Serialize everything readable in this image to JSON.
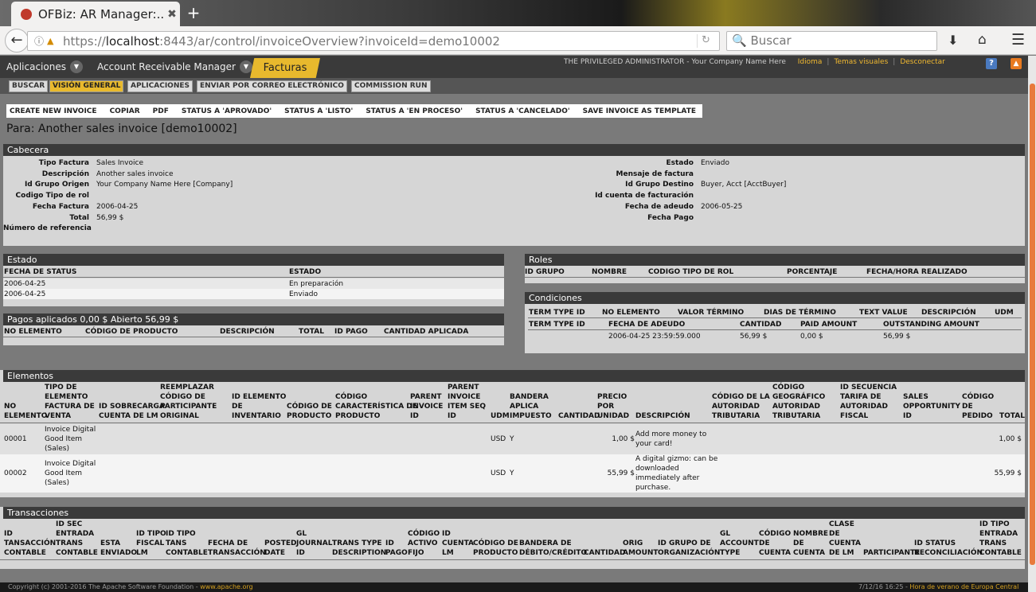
{
  "browser": {
    "tab_title": "OFBiz: AR Manager:...",
    "tab_close": "✖",
    "new_tab": "+",
    "back": "←",
    "url_host": "localhost",
    "url_prefix": "https://",
    "url_rest": ":8443/ar/control/invoiceOverview?invoiceId=demo10002",
    "search_placeholder": "Buscar"
  },
  "topnav": {
    "aplicaciones": "Aplicaciones",
    "account_manager": "Account Receivable Manager",
    "facturas": "Facturas",
    "user": "THE PRIVILEGED ADMINISTRATOR - Your Company Name Here",
    "idioma": "Idioma",
    "temas": "Temas visuales",
    "desconectar": "Desconectar",
    "help": "?"
  },
  "subnav": [
    "BUSCAR",
    "VISIÓN GENERAL",
    "APLICACIONES",
    "ENVIAR POR CORREO ELECTRÓNICO",
    "COMMISSION RUN"
  ],
  "actions": [
    "CREATE NEW INVOICE",
    "COPIAR",
    "PDF",
    "STATUS A 'APROVADO'",
    "STATUS A 'LISTO'",
    "STATUS A 'EN PROCESO'",
    "STATUS A 'CANCELADO'",
    "SAVE INVOICE AS TEMPLATE"
  ],
  "page_title": "Para: Another sales invoice [demo10002]",
  "cabecera": {
    "title": "Cabecera",
    "left": [
      {
        "k": "Tipo Factura",
        "v": "Sales Invoice"
      },
      {
        "k": "Descripción",
        "v": "Another sales invoice"
      },
      {
        "k": "Id Grupo Origen",
        "v": "Your Company Name Here [Company]"
      },
      {
        "k": "Codigo Tipo de rol",
        "v": ""
      },
      {
        "k": "Fecha Factura",
        "v": "2006-04-25"
      },
      {
        "k": "Total",
        "v": "56,99 $"
      },
      {
        "k": "Número de referencia",
        "v": ""
      }
    ],
    "right": [
      {
        "k": "Estado",
        "v": "Enviado"
      },
      {
        "k": "Mensaje de factura",
        "v": ""
      },
      {
        "k": "Id Grupo Destino",
        "v": "Buyer, Acct [AcctBuyer]"
      },
      {
        "k": "Id cuenta de facturación",
        "v": ""
      },
      {
        "k": "Fecha de adeudo",
        "v": "2006-05-25"
      },
      {
        "k": "Fecha Pago",
        "v": ""
      }
    ]
  },
  "estado": {
    "title": "Estado",
    "headers": [
      "FECHA DE STATUS",
      "ESTADO"
    ],
    "rows": [
      [
        "2006-04-25",
        "En preparación"
      ],
      [
        "2006-04-25",
        "Enviado"
      ]
    ]
  },
  "roles": {
    "title": "Roles",
    "headers": [
      "ID GRUPO",
      "NOMBRE",
      "CODIGO TIPO DE ROL",
      "PORCENTAJE",
      "FECHA/HORA REALIZADO"
    ]
  },
  "pagos": {
    "title": "Pagos aplicados 0,00 $ Abierto 56,99 $",
    "headers": [
      "NO ELEMENTO",
      "CÓDIGO DE PRODUCTO",
      "DESCRIPCIÓN",
      "TOTAL",
      "ID PAGO",
      "CANTIDAD APLICADA"
    ]
  },
  "condiciones": {
    "title": "Condiciones",
    "headers1": [
      "TERM TYPE ID",
      "NO ELEMENTO",
      "VALOR TÉRMINO",
      "DIAS DE TÉRMINO",
      "TEXT VALUE",
      "DESCRIPCIÓN",
      "UDM"
    ],
    "headers2": [
      "TERM TYPE ID",
      "FECHA DE ADEUDO",
      "CANTIDAD",
      "PAID AMOUNT",
      "OUTSTANDING AMOUNT"
    ],
    "row": [
      "",
      "2006-04-25 23:59:59.000",
      "56,99 $",
      "0,00 $",
      "56,99 $"
    ]
  },
  "elementos": {
    "title": "Elementos",
    "headers": [
      "NO\nELEMENTO",
      "TIPO DE\nELEMENTO\nFACTURA DE\nVENTA",
      "ID SOBRECARGA\nCUENTA DE LM",
      "REEMPLAZAR\nCÓDIGO DE\nPARTICIPANTE\nORIGINAL",
      "ID ELEMENTO\nDE\nINVENTARIO",
      "CÓDIGO DE\nPRODUCTO",
      "CÓDIGO\nCARACTERÍSTICA DE\nPRODUCTO",
      "PARENT\nINVOICE\nID",
      "PARENT\nINVOICE\nITEM SEQ\nID",
      "UDM",
      "BANDERA\nAPLICA\nIMPUESTO",
      "CANTIDAD",
      "PRECIO\nPOR\nUNIDAD",
      "DESCRIPCIÓN",
      "CÓDIGO DE LA\nAUTORIDAD\nTRIBUTARIA",
      "CÓDIGO\nGEOGRÁFICO\nAUTORIDAD\nTRIBUTARIA",
      "ID SECUENCIA\nTARIFA DE\nAUTORIDAD\nFISCAL",
      "SALES\nOPPORTUNITY\nID",
      "CÓDIGO\nDE\nPEDIDO",
      "TOTAL"
    ],
    "rows": [
      {
        "no": "00001",
        "tipo": "Invoice Digital\nGood Item\n(Sales)",
        "udm": "USD",
        "bandera": "Y",
        "precio": "1,00 $",
        "desc": "Add more money to\nyour card!",
        "total": "1,00 $"
      },
      {
        "no": "00002",
        "tipo": "Invoice Digital\nGood Item\n(Sales)",
        "udm": "USD",
        "bandera": "Y",
        "precio": "55,99 $",
        "desc": "A digital gizmo: can be\ndownloaded\nimmediately after\npurchase.",
        "total": "55,99 $"
      }
    ]
  },
  "transacciones": {
    "title": "Transacciones",
    "headers": [
      "ID\nTANSACCIÓN\nCONTABLE",
      "ID SEC\nENTRADA\nTRANS\nCONTABLE",
      "ESTA\nENVIADO",
      "ID TIPO\nFISCAL\nLM",
      "ID TIPO\nTANS\nCONTABLE",
      "FECHA DE\nTRANSACCIÓN",
      "POSTED\nDATE",
      "GL\nJOURNAL\nID",
      "TRANS TYPE\nDESCRIPTION",
      "ID\nPAGO",
      "CÓDIGO\nACTIVO\nFIJO",
      "ID\nCUENTA\nLM",
      "CÓDIGO DE\nPRODUCTO",
      "BANDERA DE\nDÉBITO/CRÉDITO",
      "CANTIDAD",
      "ORIG\nAMOUNT",
      "ID GRUPO DE\nORGANIZACIÓN",
      "GL\nACCOUNT\nTYPE",
      "CÓDIGO\nDE\nCUENTA",
      "NOMBRE\nDE\nCUENTA",
      "CLASE\nDE\nCUENTA\nDE LM",
      "PARTICIPANTE",
      "ID STATUS\nRECONCILIACIÓN",
      "ID TIPO\nENTRADA\nTRANS\nCONTABLE"
    ]
  },
  "footer": {
    "copyright": "Copyright (c) 2001-2016 The Apache Software Foundation - ",
    "link": "www.apache.org",
    "time": "7/12/16 16:25 - ",
    "tz": "Hora de verano de Europa Central"
  }
}
